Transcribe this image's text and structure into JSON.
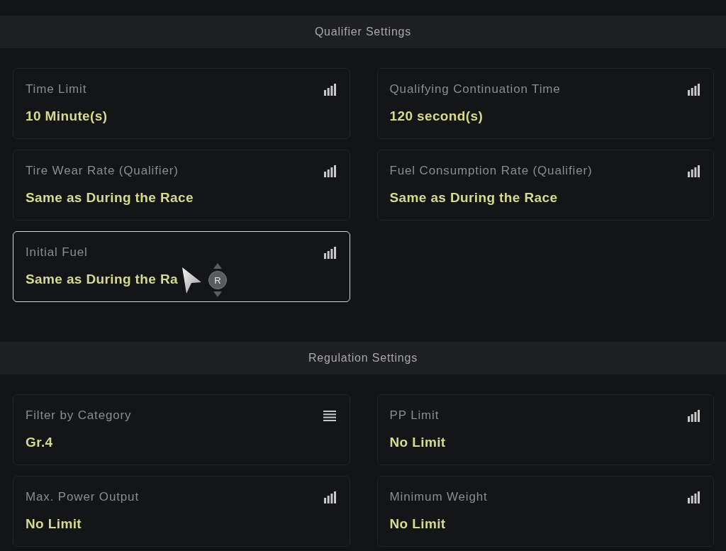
{
  "sections": [
    {
      "title": "Qualifier Settings",
      "settings": [
        {
          "label": "Time Limit",
          "value": "10 Minute(s)",
          "kind": "level",
          "selected": false
        },
        {
          "label": "Qualifying Continuation Time",
          "value": "120 second(s)",
          "kind": "level",
          "selected": false
        },
        {
          "label": "Tire Wear Rate (Qualifier)",
          "value": "Same as During the Race",
          "kind": "level",
          "selected": false
        },
        {
          "label": "Fuel Consumption Rate (Qualifier)",
          "value": "Same as During the Race",
          "kind": "level",
          "selected": false
        },
        {
          "label": "Initial Fuel",
          "value": "Same as During the Ra",
          "kind": "level",
          "selected": true
        }
      ]
    },
    {
      "title": "Regulation Settings",
      "settings": [
        {
          "label": "Filter by Category",
          "value": "Gr.4",
          "kind": "list",
          "selected": false
        },
        {
          "label": "PP Limit",
          "value": "No Limit",
          "kind": "level",
          "selected": false
        },
        {
          "label": "Max. Power Output",
          "value": "No Limit",
          "kind": "level",
          "selected": false
        },
        {
          "label": "Minimum Weight",
          "value": "No Limit",
          "kind": "level",
          "selected": false
        }
      ]
    }
  ],
  "cursor": {
    "button_label": "R"
  }
}
